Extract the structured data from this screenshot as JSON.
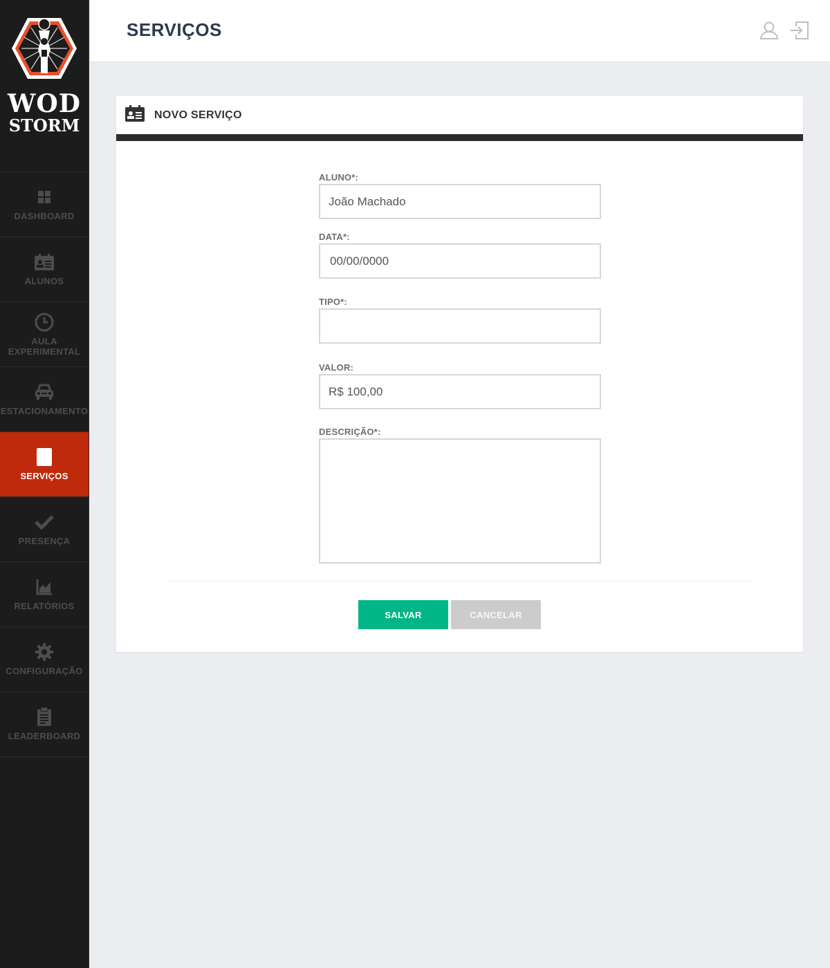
{
  "brand": {
    "line1": "WOD",
    "line2": "STORM"
  },
  "sidebar": {
    "items": [
      {
        "label": "DASHBOARD",
        "icon": "dashboard-icon"
      },
      {
        "label": "ALUNOS",
        "icon": "id-card-icon"
      },
      {
        "label": "AULA EXPERIMENTAL",
        "icon": "clock-icon"
      },
      {
        "label": "ESTACIONAMENTO",
        "icon": "car-icon"
      },
      {
        "label": "SERVIÇOS",
        "icon": "book-icon",
        "active": true
      },
      {
        "label": "PRESENÇA",
        "icon": "check-icon"
      },
      {
        "label": "RELATÓRIOS",
        "icon": "chart-icon"
      },
      {
        "label": "CONFIGURAÇÃO",
        "icon": "gear-icon"
      },
      {
        "label": "LEADERBOARD",
        "icon": "clipboard-icon"
      }
    ]
  },
  "header": {
    "title": "SERVIÇOS",
    "icons": [
      "user-icon",
      "logout-icon"
    ]
  },
  "card": {
    "title": "NOVO SERVIÇO",
    "icon": "id-card-icon"
  },
  "form": {
    "aluno": {
      "label": "ALUNO*:",
      "value": "João Machado"
    },
    "data": {
      "label": "DATA*:",
      "value": "00/00/0000"
    },
    "tipo": {
      "label": "TIPO*:",
      "value": ""
    },
    "valor": {
      "label": "VALOR:",
      "value": "R$ 100,00"
    },
    "descricao": {
      "label": "DESCRIÇÃO*:",
      "value": ""
    }
  },
  "buttons": {
    "save": "SALVAR",
    "cancel": "CANCELAR"
  },
  "colors": {
    "sidebar_bg": "#1c1c1c",
    "active": "#c02a0c",
    "save": "#00b686",
    "cancel": "#cccccc",
    "title": "#2b3a4c"
  }
}
